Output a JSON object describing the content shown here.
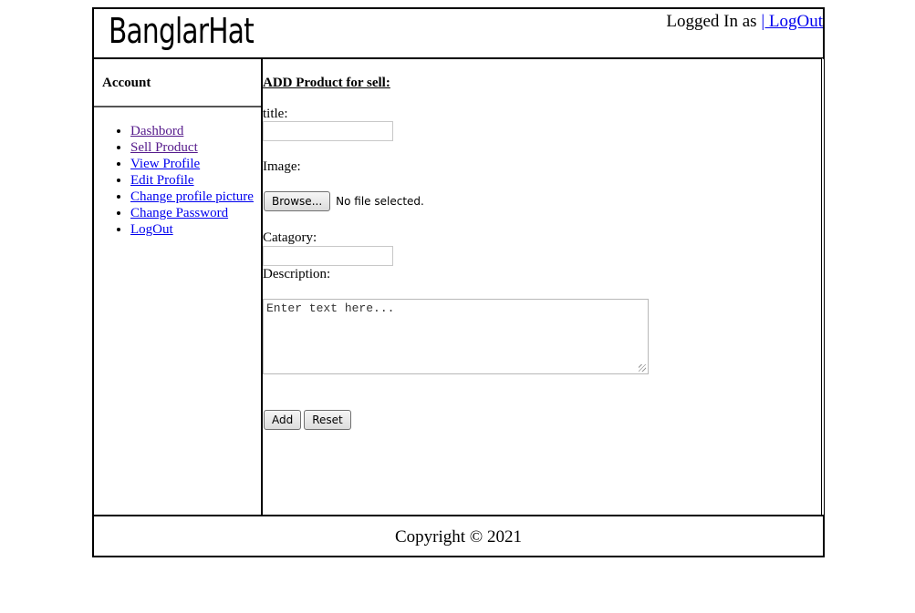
{
  "header": {
    "logo": "BanglarHat",
    "logged_in_text": "Logged In as ",
    "logout_link": "| LogOut"
  },
  "sidebar": {
    "title": "Account",
    "items": [
      {
        "label": "Dashbord"
      },
      {
        "label": "Sell Product"
      },
      {
        "label": "View Profile"
      },
      {
        "label": "Edit Profile"
      },
      {
        "label": "Change profile picture"
      },
      {
        "label": "Change Password"
      },
      {
        "label": "LogOut"
      }
    ]
  },
  "form": {
    "heading": "ADD Product for sell:",
    "title_label": "title:",
    "title_value": "",
    "image_label": "Image:",
    "browse_button": "Browse...",
    "file_status": "No file selected.",
    "category_label": "Catagory:",
    "category_value": "",
    "description_label": "Description:",
    "description_placeholder": "Enter text here...",
    "add_button": "Add",
    "reset_button": "Reset"
  },
  "footer": {
    "copyright": "Copyright © 2021"
  }
}
